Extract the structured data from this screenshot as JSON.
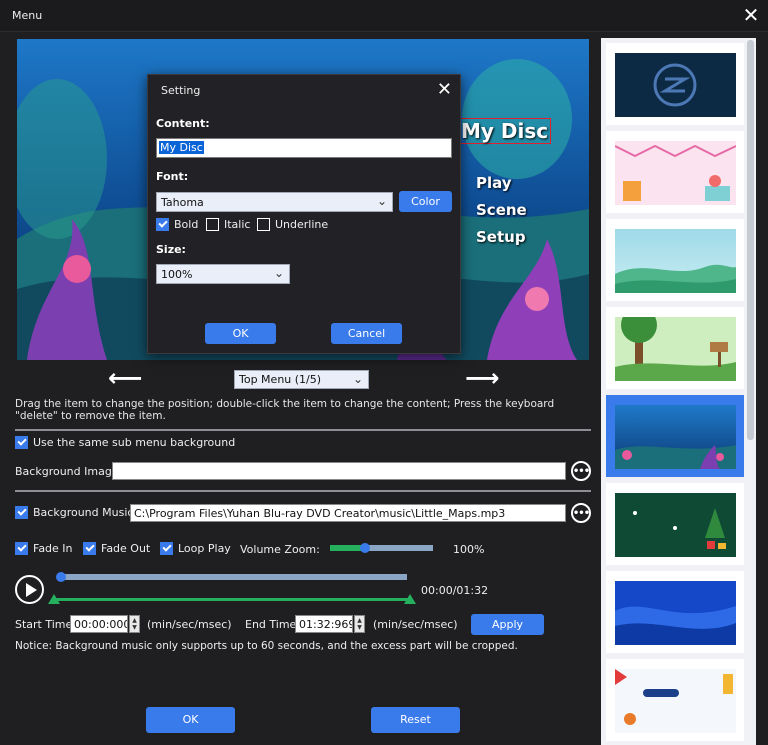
{
  "window": {
    "title": "Menu",
    "close_icon": "close-icon"
  },
  "preview": {
    "disc_title": "My Disc",
    "menu_items": [
      "Play",
      "Scene",
      "Setup"
    ],
    "page_select": "Top Menu (1/5)"
  },
  "dialog": {
    "title": "Setting",
    "content_label": "Content:",
    "content_value": "My Disc",
    "font_label": "Font:",
    "font_value": "Tahoma",
    "color_label": "Color",
    "bold_label": "Bold",
    "bold_checked": true,
    "italic_label": "Italic",
    "italic_checked": false,
    "underline_label": "Underline",
    "underline_checked": false,
    "size_label": "Size:",
    "size_value": "100%",
    "ok_label": "OK",
    "cancel_label": "Cancel"
  },
  "hint_text": "Drag the item to change the position; double-click the item to change the content; Press the keyboard \"delete\" to remove the item.",
  "background": {
    "same_sub_label": "Use the same sub menu background",
    "same_sub_checked": true,
    "image_label": "Background Image:",
    "image_value": ""
  },
  "music": {
    "label": "Background Music:",
    "checked": true,
    "path": "C:\\Program Files\\Yuhan Blu-ray DVD Creator\\music\\Little_Maps.mp3",
    "fade_in_label": "Fade In",
    "fade_in_checked": true,
    "fade_out_label": "Fade Out",
    "fade_out_checked": true,
    "loop_label": "Loop Play",
    "loop_checked": true,
    "volume_label": "Volume Zoom:",
    "volume_value": "100%",
    "volume_fraction": 0.34,
    "time_display": "00:00/01:32",
    "playback_fraction": 0.0,
    "start_label": "Start Time:",
    "start_value": "00:00:000",
    "start_unit": "(min/sec/msec)",
    "end_label": "End Time:",
    "end_value": "01:32:969",
    "end_unit": "(min/sec/msec)",
    "apply_label": "Apply",
    "notice": "Notice: Background music only supports up to 60 seconds, and the excess part will be cropped."
  },
  "footer": {
    "ok_label": "OK",
    "reset_label": "Reset"
  },
  "thumbnails": [
    "logo-dark",
    "pink-party",
    "green-hills",
    "forest-sign",
    "underwater",
    "christmas-green",
    "blue-waves",
    "kids-grid"
  ],
  "selected_thumbnail": 4,
  "colors": {
    "accent": "#3a7bec",
    "background": "#1f1f22",
    "slider_green": "#24b05c"
  }
}
